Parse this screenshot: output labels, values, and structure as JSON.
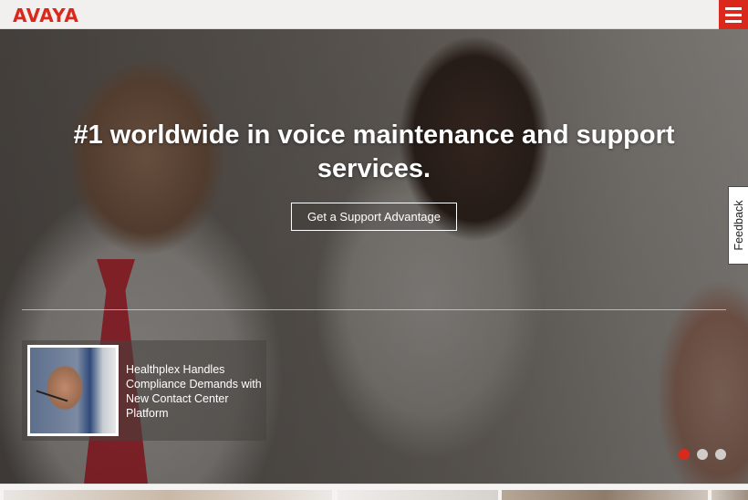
{
  "header": {
    "logo_text": "AVAYA",
    "menu_icon": "hamburger-menu-icon",
    "brand_color": "#da291c"
  },
  "hero": {
    "headline": "#1 worldwide in voice maintenance and support services.",
    "cta_label": "Get a Support Advantage",
    "story": {
      "title": "Healthplex Handles Compliance Demands with New Contact Center Platform"
    },
    "carousel": {
      "slide_count": 3,
      "active_index": 0
    }
  },
  "feedback": {
    "label": "Feedback"
  }
}
